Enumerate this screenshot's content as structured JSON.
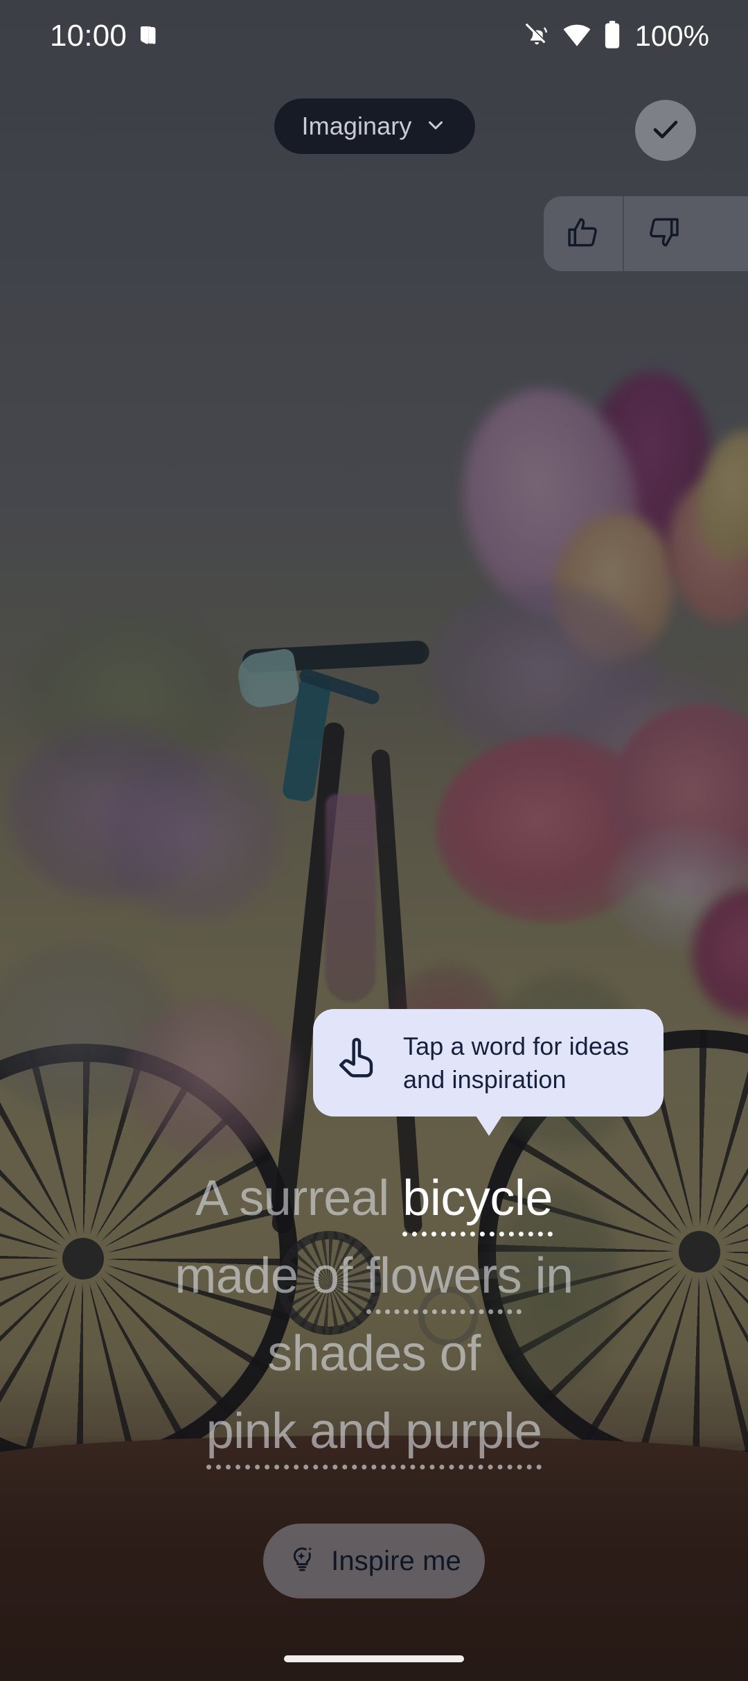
{
  "status_bar": {
    "time": "10:00",
    "battery_percent": "100%",
    "icons": {
      "notification": "app-notification-icon",
      "sound_off": "notifications-muted-icon",
      "wifi": "wifi-icon",
      "battery": "battery-full-icon"
    }
  },
  "top_bar": {
    "model_chip_label": "Imaginary",
    "model_chip_icon": "chevron-down-icon",
    "confirm_icon": "check-icon"
  },
  "feedback": {
    "thumbs_up_icon": "thumb-up-icon",
    "thumbs_down_icon": "thumb-down-icon"
  },
  "tooltip": {
    "icon": "tap-finger-icon",
    "line1": "Tap a word for ideas",
    "line2": "and inspiration",
    "background": "#E2E5FA",
    "text_color": "#16213E"
  },
  "prompt": {
    "full_text": "A surreal bicycle made of flowers in shades of pink and purple",
    "lines": [
      {
        "words": [
          {
            "text": "A surreal ",
            "active": false,
            "dotted": false
          },
          {
            "text": "bicycle",
            "active": true,
            "dotted": true
          }
        ]
      },
      {
        "words": [
          {
            "text": "made of ",
            "active": false,
            "dotted": false
          },
          {
            "text": "flowers",
            "active": false,
            "dotted": true
          },
          {
            "text": " in",
            "active": false,
            "dotted": false
          }
        ]
      },
      {
        "words": [
          {
            "text": "shades of",
            "active": false,
            "dotted": false
          }
        ]
      },
      {
        "words": [
          {
            "text": "pink and purple",
            "active": false,
            "dotted": true
          }
        ]
      }
    ]
  },
  "inspire_button": {
    "label": "Inspire me",
    "icon": "lightbulb-sparkle-icon"
  },
  "nav": {
    "home_indicator": "home-indicator"
  },
  "wallpaper": {
    "description": "A surreal bicycle made of flowers in shades of pink and purple"
  }
}
